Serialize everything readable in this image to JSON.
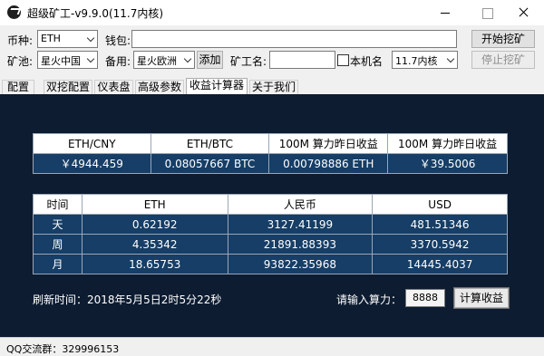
{
  "window": {
    "title": "超级矿工-v9.9.0(11.7内核)"
  },
  "toolbar": {
    "coin_label": "币种:",
    "coin_value": "ETH",
    "wallet_label": "钱包:",
    "wallet_value": "",
    "start_label": "开始挖矿",
    "pool_label": "矿池:",
    "pool_value": "星火中国",
    "backup_label": "备用:",
    "backup_value": "星火欧洲",
    "add_label": "添加",
    "worker_label": "矿工名:",
    "worker_value": "",
    "hostname_label": "本机名",
    "hostname_checked": false,
    "kernel_value": "11.7内核",
    "stop_label": "停止挖矿"
  },
  "tabs": [
    {
      "label": "配置",
      "active": false
    },
    {
      "label": "双挖配置",
      "active": false
    },
    {
      "label": "仪表盘",
      "active": false
    },
    {
      "label": "高级参数",
      "active": false
    },
    {
      "label": "收益计算器",
      "active": true
    },
    {
      "label": "关于我们",
      "active": false
    }
  ],
  "summary": {
    "headers": [
      "ETH/CNY",
      "ETH/BTC",
      "100M 算力昨日收益",
      "100M 算力昨日收益"
    ],
    "values": [
      "￥4944.459",
      "0.08057667 BTC",
      "0.00798886 ETH",
      "￥39.5006"
    ]
  },
  "earnings": {
    "headers": [
      "时间",
      "ETH",
      "人民币",
      "USD"
    ],
    "rows": [
      {
        "period": "天",
        "eth": "0.62192",
        "cny": "3127.41199",
        "usd": "481.51346"
      },
      {
        "period": "周",
        "eth": "4.35342",
        "cny": "21891.88393",
        "usd": "3370.5942"
      },
      {
        "period": "月",
        "eth": "18.65753",
        "cny": "93822.35968",
        "usd": "14445.4037"
      }
    ]
  },
  "calculator": {
    "refresh_text": "刷新时间：2018年5月5日2时5分22秒",
    "hashrate_label": "请输入算力：",
    "hashrate_value": "8888",
    "calc_button": "计算收益"
  },
  "status": {
    "qq_text": "QQ交流群：329996153"
  },
  "colors": {
    "panel_bg": "#0d1c31",
    "data_cell_bg": "#163e66"
  }
}
